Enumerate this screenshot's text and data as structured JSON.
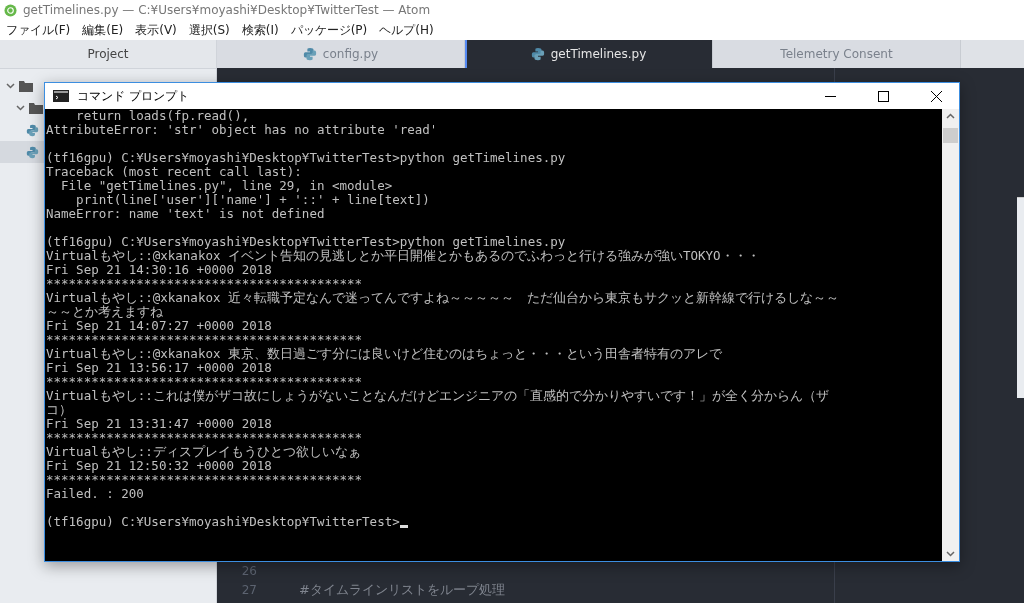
{
  "window": {
    "title": "getTimelines.py — C:¥Users¥moyashi¥Desktop¥TwitterTest — Atom"
  },
  "menu": [
    "ファイル(F)",
    "編集(E)",
    "表示(V)",
    "選択(S)",
    "検索(I)",
    "パッケージ(P)",
    "ヘルプ(H)"
  ],
  "project_panel": {
    "title": "Project",
    "tree": [
      {
        "kind": "folder",
        "selected": false,
        "children": [
          {
            "kind": "folder",
            "selected": false,
            "children": [
              {
                "kind": "python",
                "selected": false
              },
              {
                "kind": "python",
                "selected": true
              }
            ]
          }
        ]
      }
    ]
  },
  "tabs": [
    {
      "label": "config.py",
      "kind": "python",
      "selected": false
    },
    {
      "label": "getTimelines.py",
      "kind": "python",
      "selected": true
    },
    {
      "label": "Telemetry Consent",
      "kind": "plain",
      "selected": false
    }
  ],
  "editor": {
    "bottom_lines": [
      {
        "number": "26"
      },
      {
        "number": "27",
        "code": "#タイムラインリストをループ処理"
      }
    ]
  },
  "console": {
    "title": "コマンド プロンプト",
    "blocks": [
      [
        "    return loads(fp.read(),",
        "AttributeError: 'str' object has no attribute 'read'"
      ],
      [
        "(tf16gpu) C:¥Users¥moyashi¥Desktop¥TwitterTest>python getTimelines.py",
        "Traceback (most recent call last):",
        "  File \"getTimelines.py\", line 29, in <module>",
        "    print(line['user']['name'] + '::' + line[text])",
        "NameError: name 'text' is not defined"
      ],
      [
        "(tf16gpu) C:¥Users¥moyashi¥Desktop¥TwitterTest>python getTimelines.py",
        "Virtualもやし::@xkanakox イベント告知の見逃しとか平日開催とかもあるのでふわっと行ける強みが強いTOKYO・・・",
        "Fri Sep 21 14:30:16 +0000 2018",
        "******************************************",
        "Virtualもやし::@xkanakox 近々転職予定なんで迷ってんですよね～～～～～　ただ仙台から東京もサクッと新幹線で行けるしな～～",
        "～～とか考えますね",
        "Fri Sep 21 14:07:27 +0000 2018",
        "******************************************",
        "Virtualもやし::@xkanakox 東京、数日過ごす分には良いけど住むのはちょっと・・・という田舎者特有のアレで",
        "Fri Sep 21 13:56:17 +0000 2018",
        "******************************************",
        "Virtualもやし::これは僕がザコ故にしょうがないことなんだけどエンジニアの「直感的で分かりやすいです！」が全く分からん（ザ",
        "コ）",
        "Fri Sep 21 13:31:47 +0000 2018",
        "******************************************",
        "Virtualもやし::ディスプレイもうひとつ欲しいなぁ",
        "Fri Sep 21 12:50:32 +0000 2018",
        "******************************************",
        "Failed. : 200"
      ],
      [
        "(tf16gpu) C:¥Users¥moyashi¥Desktop¥TwitterTest>"
      ]
    ]
  }
}
